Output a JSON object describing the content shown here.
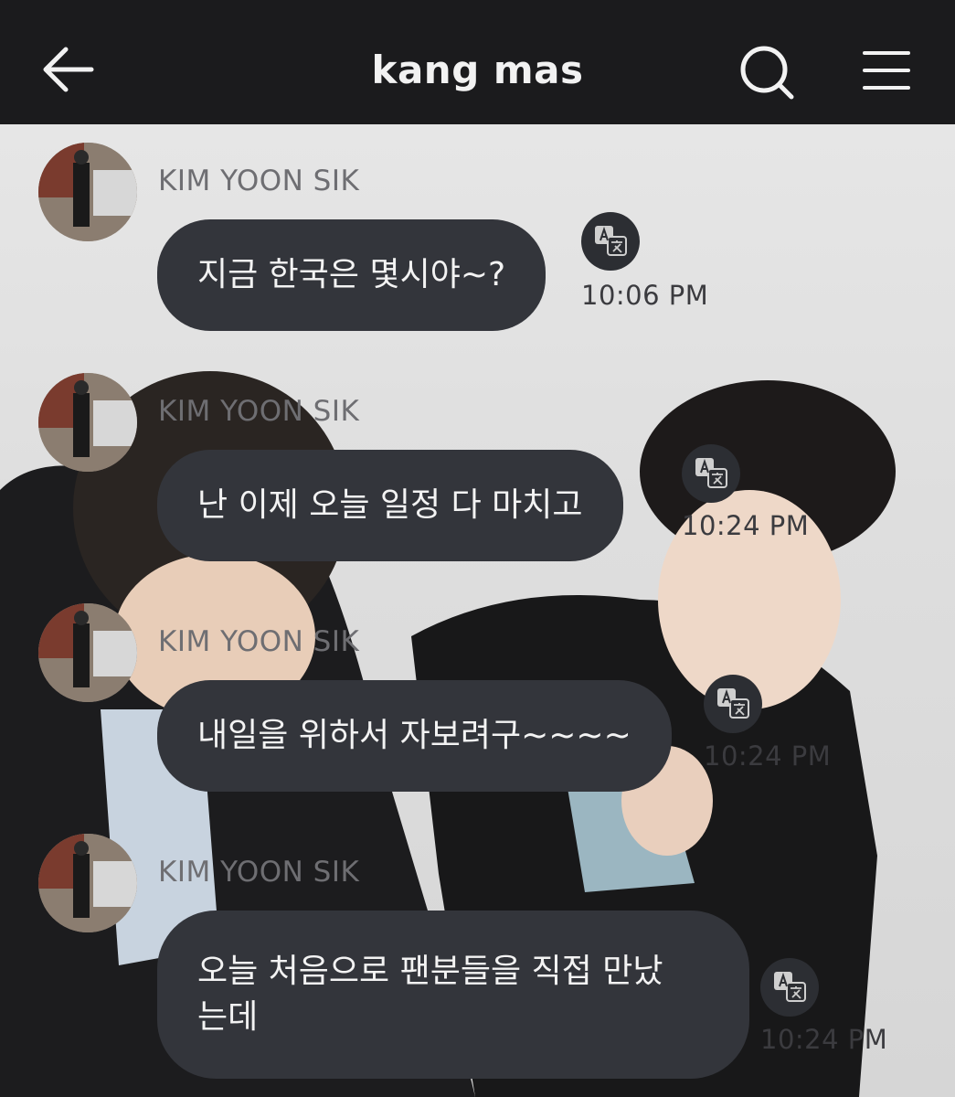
{
  "header": {
    "title": "kang mas",
    "back_icon": "back-arrow-icon",
    "search_icon": "search-icon",
    "menu_icon": "menu-icon"
  },
  "colors": {
    "header_bg": "#1b1b1d",
    "bubble_bg": "#33353b",
    "bubble_text": "#f3f3f3",
    "sender_text": "#6e6e72"
  },
  "messages": [
    {
      "sender": "KIM YOON SIK",
      "text": "지금 한국은 몇시야~?",
      "time": "10:06 PM"
    },
    {
      "sender": "KIM YOON SIK",
      "text": "난 이제 오늘 일정 다 마치고",
      "time": "10:24 PM"
    },
    {
      "sender": "KIM YOON SIK",
      "text": "내일을 위하서 자보려구~~~~",
      "time": "10:24 PM"
    },
    {
      "sender": "KIM YOON SIK",
      "text": "오늘 처음으로 팬분들을 직접 만났\n는데",
      "time": "10:24 PM"
    }
  ]
}
